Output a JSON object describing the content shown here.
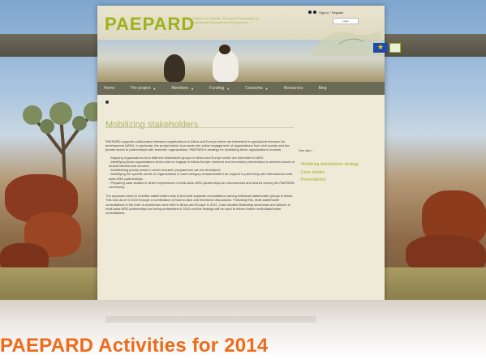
{
  "header": {
    "logo": "PAEPARD",
    "tagline": "Platform for African - European Partnership on Agricultural Research for Development",
    "login_label": "Sign in / Register",
    "login_button": "Login"
  },
  "nav": {
    "items": [
      {
        "label": "Home",
        "has_caret": false
      },
      {
        "label": "The project",
        "has_caret": true
      },
      {
        "label": "Members",
        "has_caret": true
      },
      {
        "label": "Funding",
        "has_caret": true
      },
      {
        "label": "Consortia",
        "has_caret": true
      },
      {
        "label": "Resources",
        "has_caret": false
      },
      {
        "label": "Blog",
        "has_caret": false
      }
    ]
  },
  "main": {
    "title": "Mobilizing stakeholders",
    "paragraphs": [
      "PAEPARD supports collaboration between organizations in Africa and Europe which are interested in agricultural research for development (ARD). In particular, the project seeks to promote the active engagement of organizations from civil society and the private sector in partnerships with research organizations. PAEPARD's strategy for mobilizing these organizations involves:"
    ],
    "items": [
      "- Mapping organizations from different stakeholder groups in Africa and Europe which are interested in ARD;",
      "- Identifying those organizations which wish to engage in Africa-Europe research and innovation partnerships to address issues of mutual interest and concern;",
      "- Establishing priority areas in which research programmes can be developed;",
      "- Identifying the specific needs of organizations in each category of stakeholders for support in partnering with international multi-actor ARD partnerships;",
      "- Preparing case studies in which experiences of multi-actor ARD partnerships are documented and shared among the PAEPARD community."
    ],
    "closing": "The approach used to mobilize stakeholders was to first hold separate consultations among individual stakeholder groups in Africa. This was done in 2010 through a combination of face-to-face and electronic discussions. Following this, multi-stakeholder consultations in the form of workshops were held in Africa and Europe in 2011. Case studies illustrating successes and failures in multi-actor ARD partnerships are being undertaken in 2012 and the findings will be used to inform further multi-stakeholder consultations."
  },
  "sidebar": {
    "heading": "See also :",
    "links": [
      "- Mobilizing stakeholders strategy",
      "- Case studies",
      "- Presentations"
    ]
  },
  "footer": {
    "title": "PAEPARD Activities for 2014"
  },
  "colors": {
    "accent": "#9ab21c",
    "nav_bg": "#6a6a56",
    "title_orange": "#ef6a1a",
    "page_bg": "#efead8"
  }
}
